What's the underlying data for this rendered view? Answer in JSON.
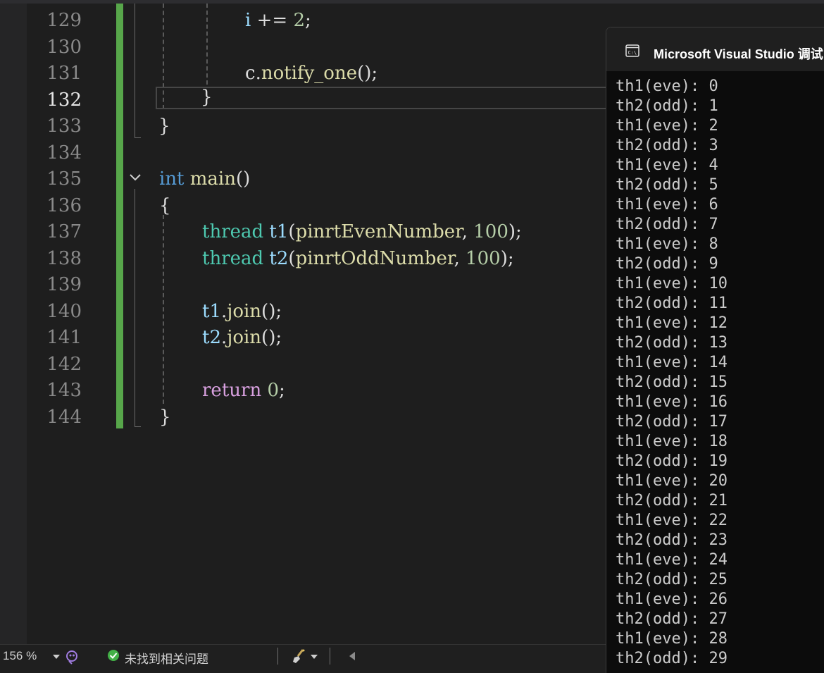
{
  "editor": {
    "current_line": "132",
    "line_numbers": [
      "129",
      "130",
      "131",
      "132",
      "133",
      "134",
      "135",
      "136",
      "137",
      "138",
      "139",
      "140",
      "141",
      "142",
      "143",
      "144"
    ],
    "code": {
      "l129": {
        "var": "i",
        "op": " += ",
        "num": "2",
        "end": ";"
      },
      "l131": {
        "obj": "c",
        "dot": ".",
        "fn": "notify_one",
        "end": "();"
      },
      "l132": {
        "brace": "}"
      },
      "l133": {
        "brace": "}"
      },
      "l135": {
        "kw": "int",
        "fn": "main",
        "end": "()"
      },
      "l136": {
        "brace": "{"
      },
      "l137": {
        "ty": "thread",
        "var": "t1",
        "open": "(",
        "arg": "pinrtEvenNumber",
        "sep": ", ",
        "num": "100",
        "end": ");"
      },
      "l138": {
        "ty": "thread",
        "var": "t2",
        "open": "(",
        "arg": "pinrtOddNumber",
        "sep": ", ",
        "num": "100",
        "end": ");"
      },
      "l140": {
        "var": "t1",
        "dot": ".",
        "fn": "join",
        "end": "();"
      },
      "l141": {
        "var": "t2",
        "dot": ".",
        "fn": "join",
        "end": "();"
      },
      "l143": {
        "kw": "return",
        "num": "0",
        "end": ";"
      },
      "l144": {
        "brace": "}"
      }
    }
  },
  "console": {
    "title": "Microsoft Visual Studio 调试",
    "output": [
      "th1(eve): 0",
      "th2(odd): 1",
      "th1(eve): 2",
      "th2(odd): 3",
      "th1(eve): 4",
      "th2(odd): 5",
      "th1(eve): 6",
      "th2(odd): 7",
      "th1(eve): 8",
      "th2(odd): 9",
      "th1(eve): 10",
      "th2(odd): 11",
      "th1(eve): 12",
      "th2(odd): 13",
      "th1(eve): 14",
      "th2(odd): 15",
      "th1(eve): 16",
      "th2(odd): 17",
      "th1(eve): 18",
      "th2(odd): 19",
      "th1(eve): 20",
      "th2(odd): 21",
      "th1(eve): 22",
      "th2(odd): 23",
      "th1(eve): 24",
      "th2(odd): 25",
      "th1(eve): 26",
      "th2(odd): 27",
      "th1(eve): 28",
      "th2(odd): 29"
    ]
  },
  "statusbar": {
    "zoom": "156 %",
    "issues": "未找到相关问题"
  },
  "colors": {
    "change_bar": "#57a64a",
    "keyword": "#569cd6",
    "type": "#4ec9b0",
    "function": "#dcdcaa",
    "number": "#b5cea8",
    "variable": "#9cdcfe",
    "control": "#d8a0df"
  },
  "icons": [
    "console-app-icon",
    "chevron-down-icon",
    "copilot-icon",
    "check-circle-icon",
    "brush-icon",
    "arrow-left-icon"
  ]
}
